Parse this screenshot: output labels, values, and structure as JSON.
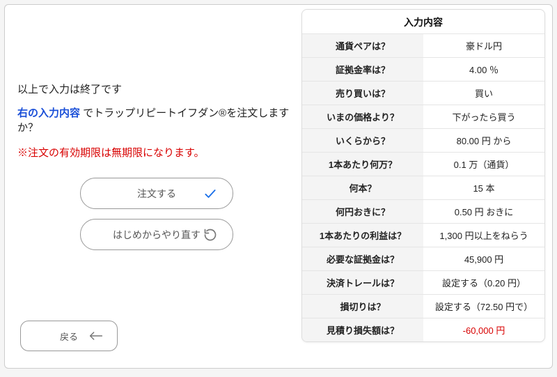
{
  "left": {
    "line1": "以上で入力は終了です",
    "line2_highlight": "右の入力内容",
    "line2_rest": " でトラップリピートイフダン®を注文しますか？",
    "line3": "※注文の有効期限は無期限になります。",
    "submit_label": "注文する",
    "restart_label": "はじめからやり直す",
    "back_label": "戻る"
  },
  "summary": {
    "title": "入力内容",
    "rows": [
      {
        "label": "通貨ペアは？",
        "value": "豪ドル円"
      },
      {
        "label": "証拠金率は？",
        "value": "4.00 ％"
      },
      {
        "label": "売り買いは？",
        "value": "買い"
      },
      {
        "label": "いまの価格より？",
        "value": "下がったら買う"
      },
      {
        "label": "いくらから？",
        "value": "80.00 円 から"
      },
      {
        "label": "1本あたり何万？",
        "value": "0.1 万（通貨）"
      },
      {
        "label": "何本？",
        "value": "15 本"
      },
      {
        "label": "何円おきに？",
        "value": "0.50 円 おきに"
      },
      {
        "label": "1本あたりの利益は？",
        "value": "1,300 円以上をねらう"
      },
      {
        "label": "必要な証拠金は？",
        "value": "45,900 円"
      },
      {
        "label": "決済トレールは？",
        "value": "設定する（0.20 円）"
      },
      {
        "label": "損切りは？",
        "value": "設定する（72.50 円で）"
      },
      {
        "label": "見積り損失額は？",
        "value": "-60,000 円",
        "red": true
      }
    ]
  }
}
